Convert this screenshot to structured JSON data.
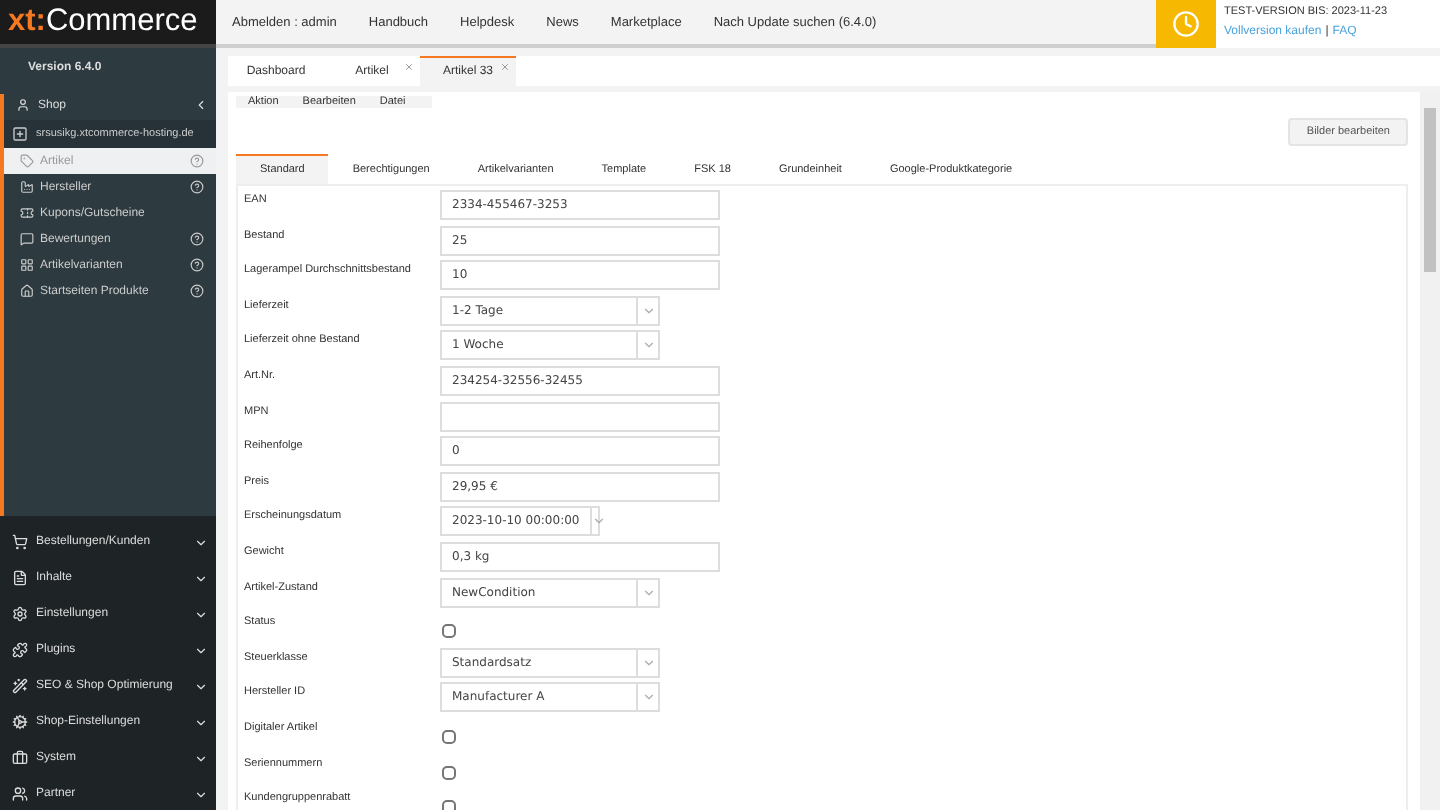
{
  "header": {
    "logo_prefix": "xt:",
    "logo_name": "Commerce",
    "nav": [
      "Abmelden : admin",
      "Handbuch",
      "Helpdesk",
      "News",
      "Marketplace",
      "Nach Update suchen (6.4.0)"
    ],
    "license": {
      "text": "TEST-VERSION BIS: 2023-11-23",
      "links": [
        "Vollversion kaufen",
        "FAQ"
      ],
      "separator": "|"
    }
  },
  "sidebar": {
    "version": "Version 6.4.0",
    "section": {
      "label": "Shop",
      "expanded": true
    },
    "domain": "srsusikg.xtcommerce-hosting.de",
    "items": [
      {
        "label": "Artikel",
        "selected": true,
        "help": true
      },
      {
        "label": "Hersteller",
        "selected": false,
        "help": true
      },
      {
        "label": "Kupons/Gutscheine",
        "selected": false,
        "help": false
      },
      {
        "label": "Bewertungen",
        "selected": false,
        "help": true
      },
      {
        "label": "Artikelvarianten",
        "selected": false,
        "help": true
      },
      {
        "label": "Startseiten Produkte",
        "selected": false,
        "help": true
      }
    ],
    "menu": [
      {
        "label": "Bestellungen/Kunden",
        "expanded": false
      },
      {
        "label": "Inhalte",
        "expanded": false
      },
      {
        "label": "Einstellungen",
        "expanded": false
      },
      {
        "label": "Plugins",
        "expanded": false
      },
      {
        "label": "SEO & Shop Optimierung",
        "expanded": false
      },
      {
        "label": "Shop-Einstellungen",
        "expanded": false
      },
      {
        "label": "System",
        "expanded": false
      },
      {
        "label": "Partner",
        "expanded": false
      }
    ]
  },
  "tabs": [
    {
      "label": "Dashboard",
      "selected": false,
      "closable": false
    },
    {
      "label": "Artikel",
      "selected": false,
      "closable": true
    },
    {
      "label": "Artikel 33",
      "selected": true,
      "closable": true
    }
  ],
  "toolbar": [
    "Aktion",
    "Bearbeiten",
    "Datei"
  ],
  "edit_images_button": "Bilder bearbeiten",
  "form_tabs": [
    {
      "label": "Standard",
      "selected": true
    },
    {
      "label": "Berechtigungen",
      "selected": false
    },
    {
      "label": "Artikelvarianten",
      "selected": false
    },
    {
      "label": "Template",
      "selected": false
    },
    {
      "label": "FSK 18",
      "selected": false
    },
    {
      "label": "Grundeinheit",
      "selected": false
    },
    {
      "label": "Google-Produktkategorie",
      "selected": false
    }
  ],
  "fields": [
    {
      "label": "EAN",
      "kind": "text",
      "value": "2334-455467-3253"
    },
    {
      "label": "Bestand",
      "kind": "text",
      "value": "25"
    },
    {
      "label": "Lagerampel Durchschnittsbestand",
      "kind": "text",
      "value": "10"
    },
    {
      "label": "Lieferzeit",
      "kind": "select",
      "value": "1-2 Tage"
    },
    {
      "label": "Lieferzeit ohne Bestand",
      "kind": "select",
      "value": "1 Woche"
    },
    {
      "label": "Art.Nr.",
      "kind": "text",
      "value": "234254-32556-32455"
    },
    {
      "label": "MPN",
      "kind": "text"
    },
    {
      "label": "Reihenfolge",
      "kind": "text",
      "value": "0"
    },
    {
      "label": "Preis",
      "kind": "text",
      "value": "29,95 €"
    },
    {
      "label": "Erscheinungsdatum",
      "kind": "date",
      "value": "2023-10-10 00:00:00"
    },
    {
      "label": "Gewicht",
      "kind": "text",
      "value": "0,3 kg"
    },
    {
      "label": "Artikel-Zustand",
      "kind": "select",
      "value": "NewCondition"
    },
    {
      "label": "Status",
      "kind": "checkbox",
      "checked": false
    },
    {
      "label": "Steuerklasse",
      "kind": "select",
      "value": "Standardsatz"
    },
    {
      "label": "Hersteller ID",
      "kind": "select",
      "value": "Manufacturer A"
    },
    {
      "label": "Digitaler Artikel",
      "kind": "checkbox",
      "checked": false
    },
    {
      "label": "Seriennummern",
      "kind": "checkbox",
      "checked": false
    },
    {
      "label": "Kundengruppenrabatt",
      "kind": "checkbox",
      "checked": false
    }
  ]
}
